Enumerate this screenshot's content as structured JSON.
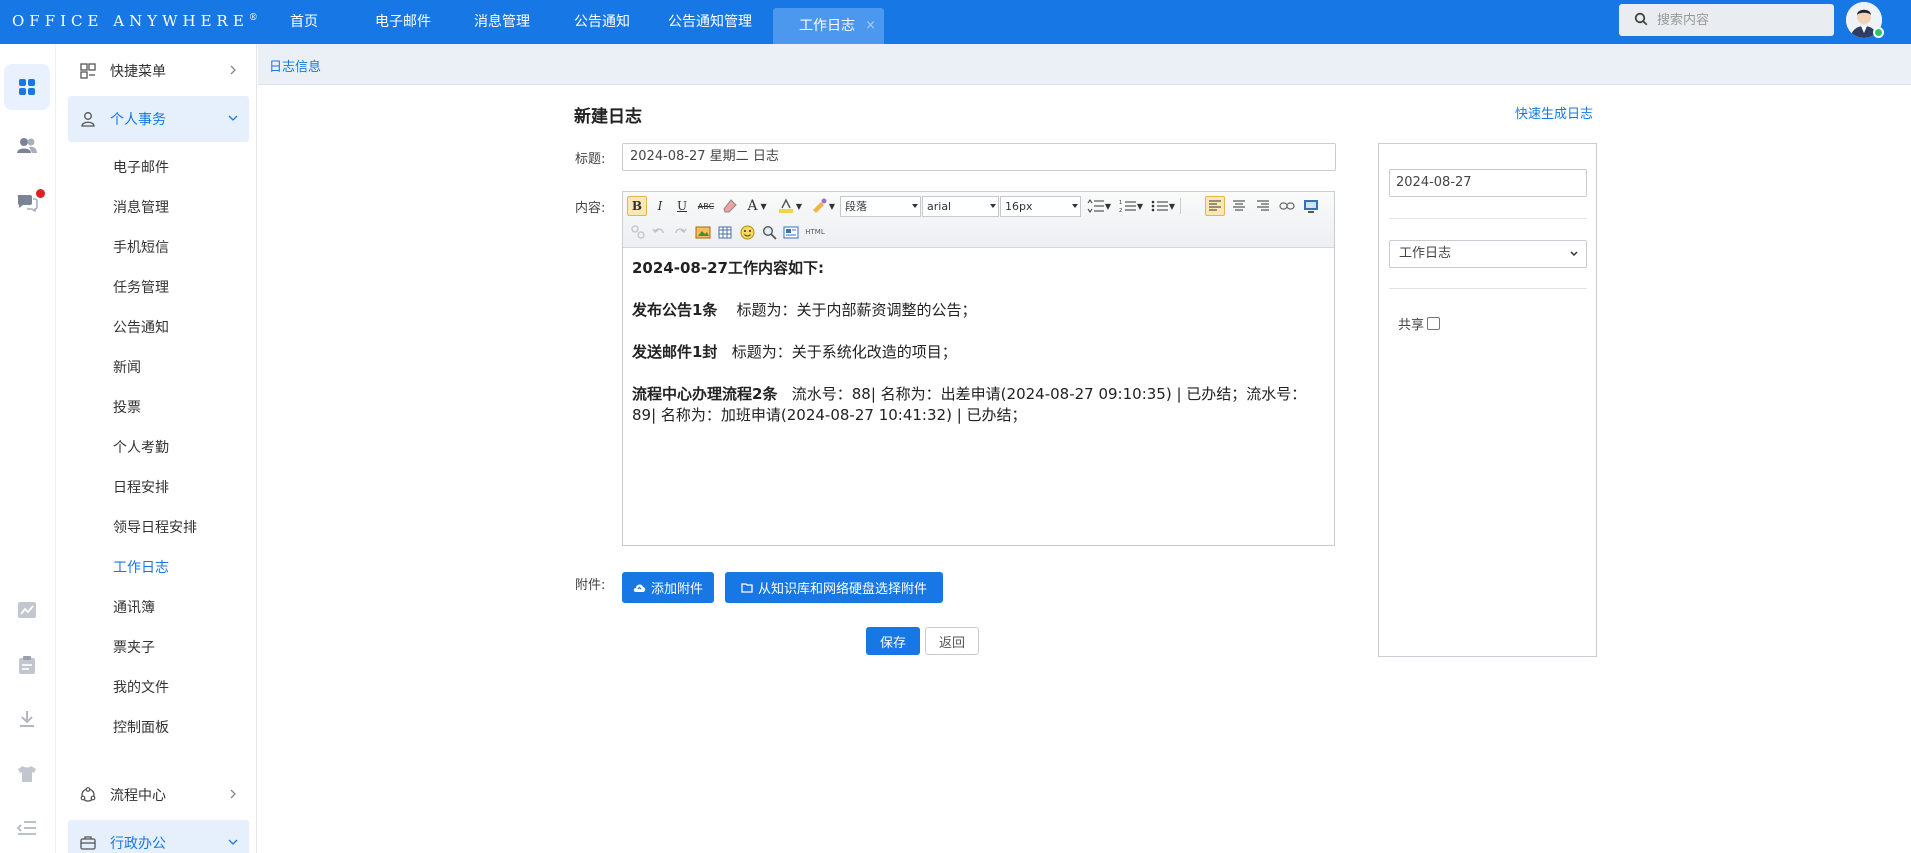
{
  "brand": {
    "name": "Office Anywhere",
    "mark": "®"
  },
  "nav": {
    "tabs": [
      {
        "label": "首页"
      },
      {
        "label": "电子邮件"
      },
      {
        "label": "消息管理"
      },
      {
        "label": "公告通知"
      },
      {
        "label": "公告通知管理"
      },
      {
        "label": "工作日志",
        "active": true
      }
    ],
    "close_label": "×"
  },
  "search": {
    "placeholder": "搜索内容"
  },
  "rail": {
    "icons": [
      "apps-icon",
      "users-icon",
      "chat-icon",
      "chart-icon",
      "clipboard-icon",
      "download-icon",
      "shirt-icon",
      "collapse-icon"
    ]
  },
  "menu": {
    "quick": "快捷菜单",
    "personal": "个人事务",
    "items": [
      "电子邮件",
      "消息管理",
      "手机短信",
      "任务管理",
      "公告通知",
      "新闻",
      "投票",
      "个人考勤",
      "日程安排",
      "领导日程安排",
      "工作日志",
      "通讯簿",
      "票夹子",
      "我的文件",
      "控制面板"
    ],
    "active_item": "工作日志",
    "flow": "流程中心",
    "admin": "行政办公"
  },
  "breadcrumb": "日志信息",
  "form": {
    "title": "新建日志",
    "quick_link": "快速生成日志",
    "title_label": "标题:",
    "title_value": "2024-08-27 星期二 日志",
    "content_label": "内容:",
    "attach_label": "附件:",
    "add_attach": "添加附件",
    "kb_attach": "从知识库和网络硬盘选择附件",
    "save": "保存",
    "back": "返回"
  },
  "editor": {
    "bold": "B",
    "italic": "I",
    "underline": "U",
    "strike": "ABC",
    "font_color": "A",
    "paragraph": "段落",
    "font": "arial",
    "size": "16px",
    "html": "HTML"
  },
  "doc": {
    "heading": "2024-08-27工作内容如下:",
    "l1_bold": "发布公告1条",
    "l1_text": "标题为：关于内部薪资调整的公告；",
    "l2_bold": "发送邮件1封",
    "l2_text": "标题为：关于系统化改造的项目；",
    "l3_bold": "流程中心办理流程2条",
    "l3_text": "流水号：88| 名称为：出差申请(2024-08-27 09:10:35) | 已办结；流水号：89| 名称为：加班申请(2024-08-27 10:41:32) | 已办结；"
  },
  "side": {
    "date": "2024-08-27",
    "type": "工作日志",
    "share": "共享"
  },
  "colors": {
    "primary": "#1677e5",
    "menu_active_bg": "#e6f0fc",
    "crumb_bg": "#eaf0f6"
  }
}
